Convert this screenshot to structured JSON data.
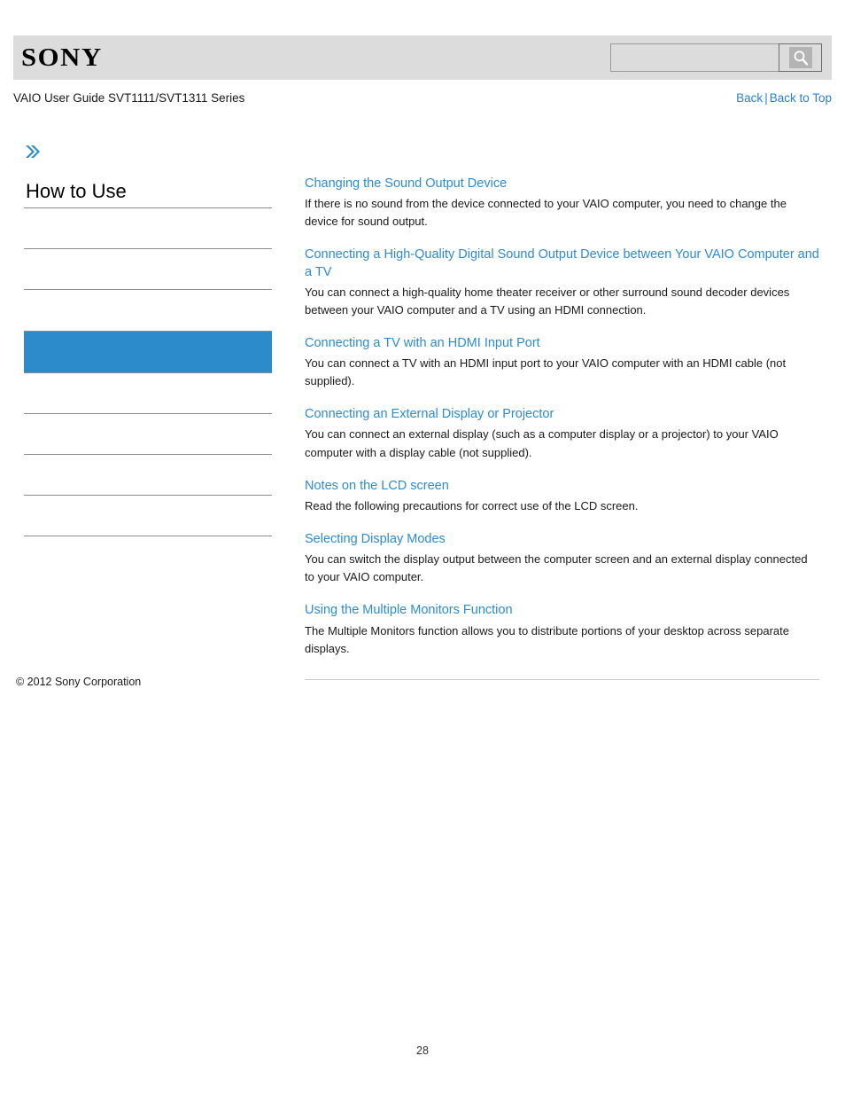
{
  "header": {
    "logo_text": "SONY",
    "search": {
      "value": "",
      "placeholder": "",
      "icon": "search-icon"
    }
  },
  "title_bar": {
    "guide_title": "VAIO User Guide SVT1111/SVT1311 Series",
    "back_label": "Back",
    "separator": "|",
    "back_to_top_label": "Back to Top"
  },
  "sidebar": {
    "expand_icon": "double-chevron-right-icon",
    "heading": "How to Use",
    "accent_color": "#2b8bcb",
    "items": [
      {
        "label": "",
        "active": false
      },
      {
        "label": "",
        "active": false
      },
      {
        "label": "",
        "active": false
      },
      {
        "label": "",
        "active": true
      },
      {
        "label": "",
        "active": false
      },
      {
        "label": "",
        "active": false
      },
      {
        "label": "",
        "active": false
      },
      {
        "label": "",
        "active": false
      }
    ]
  },
  "content": {
    "link_color": "#2c8bd4",
    "entries": [
      {
        "title": "Changing the Sound Output Device",
        "description": "If there is no sound from the device connected to your VAIO computer, you need to change the device for sound output."
      },
      {
        "title": "Connecting a High-Quality Digital Sound Output Device between Your VAIO Computer and a TV",
        "description": "You can connect a high-quality home theater receiver or other surround sound decoder devices between your VAIO computer and a TV using an HDMI connection."
      },
      {
        "title": "Connecting a TV with an HDMI Input Port",
        "description": "You can connect a TV with an HDMI input port to your VAIO computer with an HDMI cable (not supplied)."
      },
      {
        "title": "Connecting an External Display or Projector",
        "description": "You can connect an external display (such as a computer display or a projector) to your VAIO computer with a display cable (not supplied)."
      },
      {
        "title": "Notes on the LCD screen",
        "description": "Read the following precautions for correct use of the LCD screen."
      },
      {
        "title": "Selecting Display Modes",
        "description": "You can switch the display output between the computer screen and an external display connected to your VAIO computer."
      },
      {
        "title": "Using the Multiple Monitors Function",
        "description": "The Multiple Monitors function allows you to distribute portions of your desktop across separate displays."
      }
    ]
  },
  "footer": {
    "copyright": "© 2012 Sony Corporation",
    "page_number": "28"
  }
}
